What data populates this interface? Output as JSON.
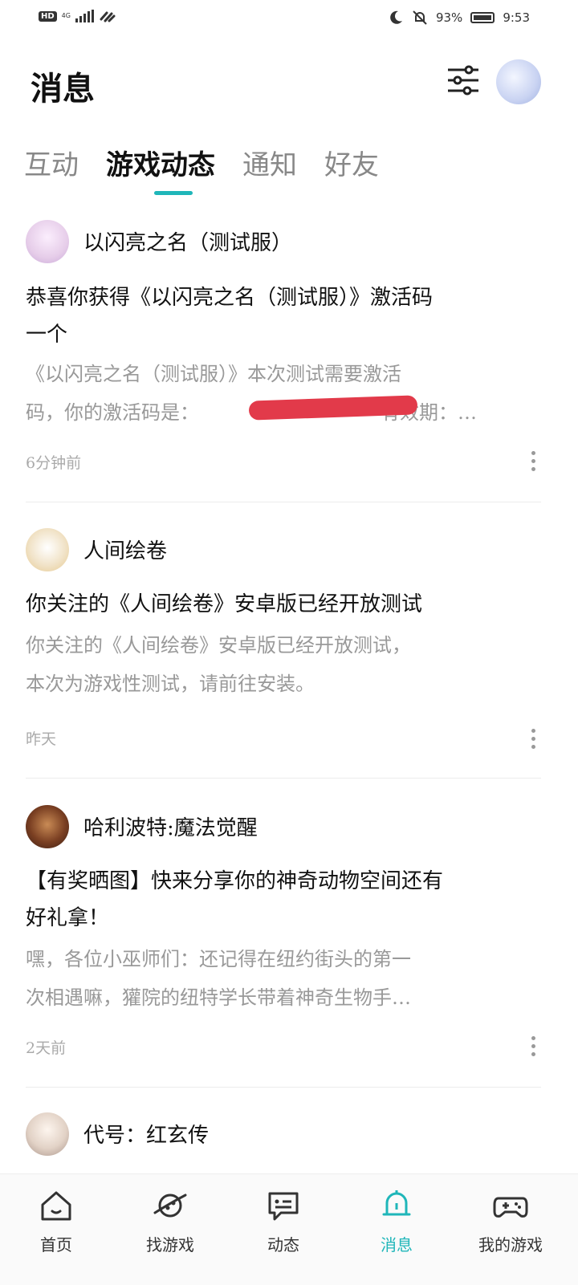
{
  "status_bar": {
    "hd": "HD",
    "network": "4G",
    "battery": "93%",
    "time": "9:53"
  },
  "header": {
    "title": "消息"
  },
  "tabs": [
    {
      "label": "互动"
    },
    {
      "label": "游戏动态"
    },
    {
      "label": "通知"
    },
    {
      "label": "好友"
    }
  ],
  "active_tab": "游戏动态",
  "feed": [
    {
      "game": "以闪亮之名（测试服）",
      "title_lines": [
        "恭喜你获得《以闪亮之名（测试服）》激活码",
        "一个"
      ],
      "body_lines": [
        "《以闪亮之名（测试服）》本次测试需要激活",
        "码，你的激活码是："
      ],
      "body_tail": "有效期：…",
      "time": "6分钟前"
    },
    {
      "game": "人间绘卷",
      "title_lines": [
        "你关注的《人间绘卷》安卓版已经开放测试"
      ],
      "body_lines": [
        "你关注的《人间绘卷》安卓版已经开放测试，",
        "本次为游戏性测试，请前往安装。"
      ],
      "time": "昨天"
    },
    {
      "game": "哈利波特:魔法觉醒",
      "title_lines": [
        "【有奖晒图】快来分享你的神奇动物空间还有",
        "好礼拿！"
      ],
      "body_lines": [
        "嘿，各位小巫师们：还记得在纽约街头的第一",
        "次相遇嘛，獾院的纽特学长带着神奇生物手…"
      ],
      "time": "2天前"
    },
    {
      "game": "代号：红玄传"
    }
  ],
  "bottom_nav": [
    {
      "label": "首页",
      "icon": "home-icon"
    },
    {
      "label": "找游戏",
      "icon": "planet-icon"
    },
    {
      "label": "动态",
      "icon": "message-icon"
    },
    {
      "label": "消息",
      "icon": "bell-icon"
    },
    {
      "label": "我的游戏",
      "icon": "gamepad-icon"
    }
  ],
  "colors": {
    "accent": "#1fb6b9",
    "redaction": "#e23a4a"
  }
}
